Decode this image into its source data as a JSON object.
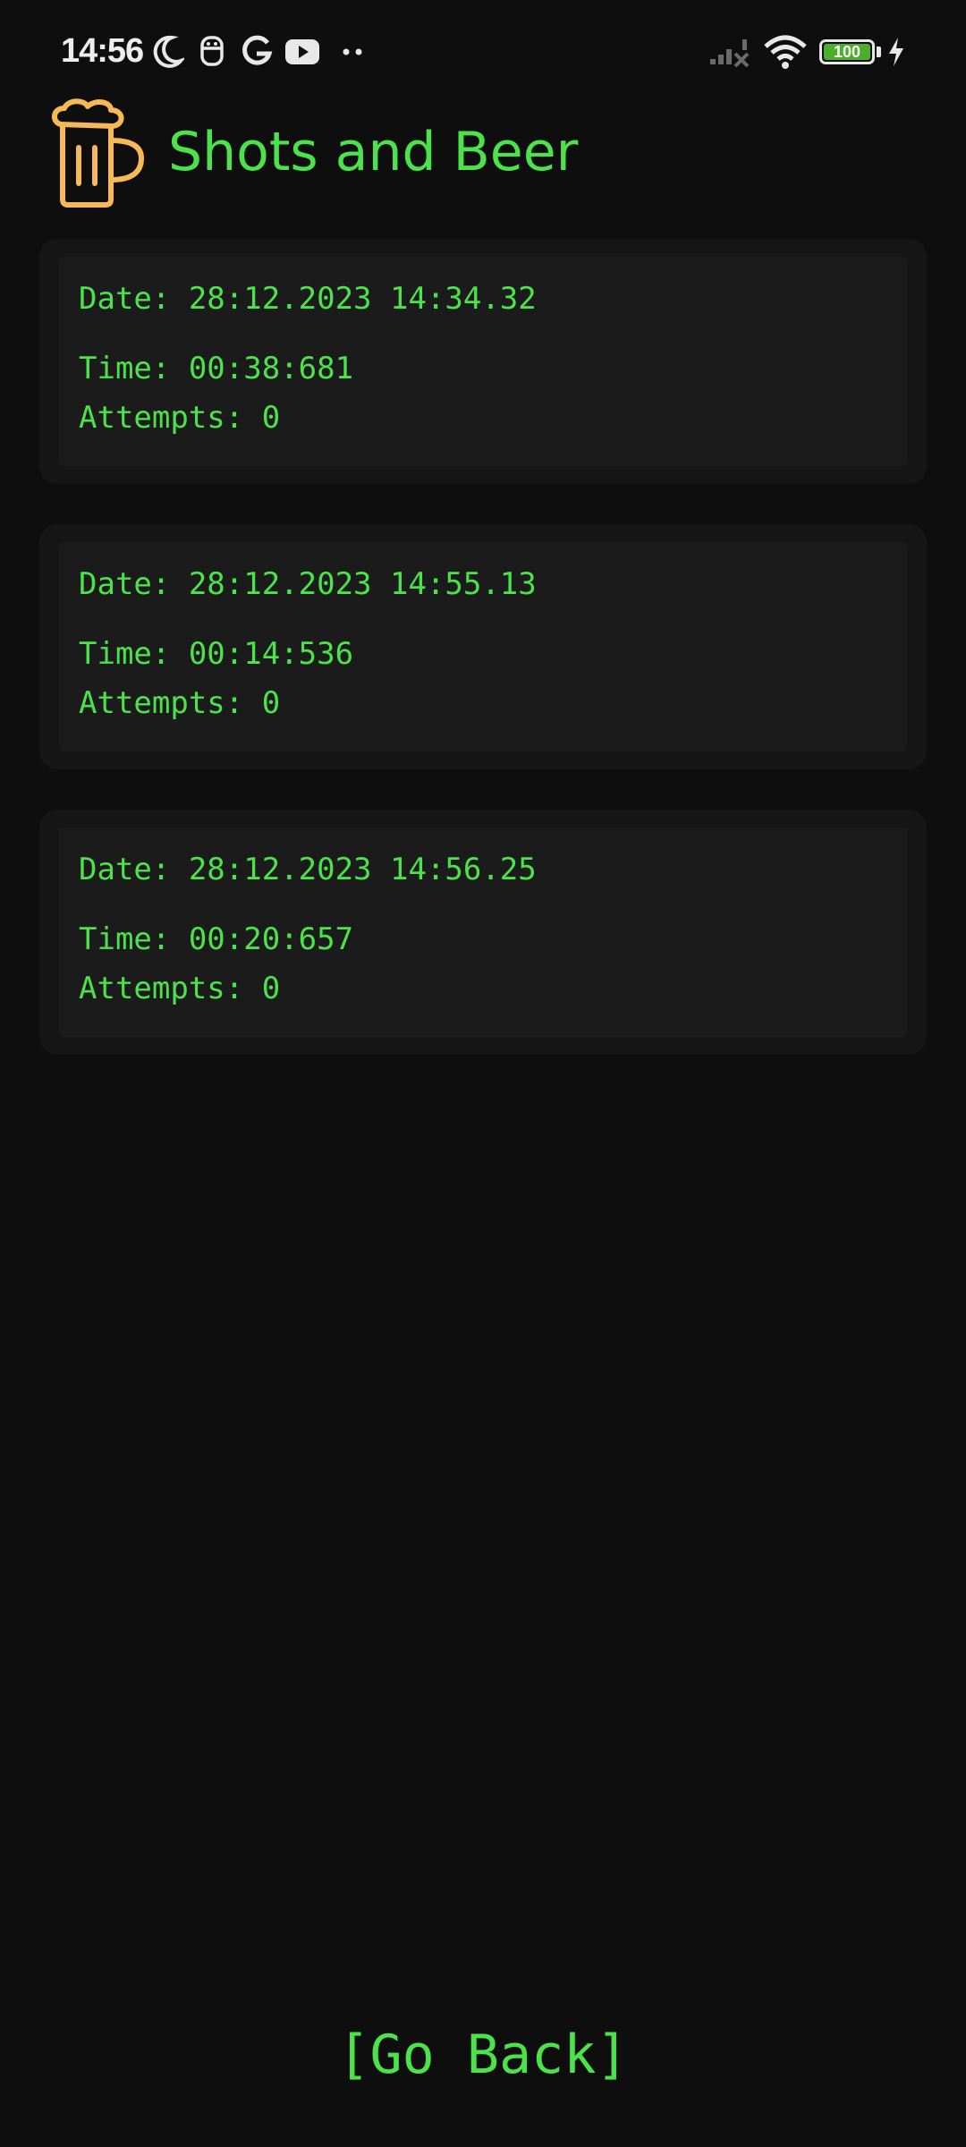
{
  "status_bar": {
    "time": "14:56",
    "battery_level": "100",
    "icons": [
      "moon-icon",
      "face-icon",
      "google-icon",
      "youtube-icon",
      "more-dots-icon",
      "signal-off-icon",
      "wifi-icon",
      "battery-icon",
      "charging-bolt-icon"
    ]
  },
  "header": {
    "title": "Shots and Beer",
    "logo": "beer-mug-icon"
  },
  "records": [
    {
      "date": "Date: 28:12.2023 14:34.32",
      "time": "Time: 00:38:681",
      "attempts": "Attempts: 0"
    },
    {
      "date": "Date: 28:12.2023 14:55.13",
      "time": "Time: 00:14:536",
      "attempts": "Attempts: 0"
    },
    {
      "date": "Date: 28:12.2023 14:56.25",
      "time": "Time: 00:20:657",
      "attempts": "Attempts: 0"
    }
  ],
  "footer": {
    "go_back_label": "[Go Back]"
  },
  "colors": {
    "background": "#0e0e0e",
    "accent_green": "#4be24a",
    "logo_orange": "#f7b955",
    "card": "#161616"
  }
}
